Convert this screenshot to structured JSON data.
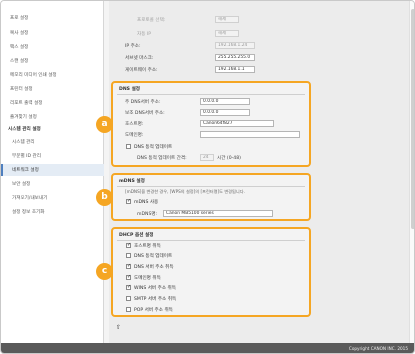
{
  "sidebar": {
    "items": [
      {
        "label": "프로 설정"
      },
      {
        "label": "복사 설정"
      },
      {
        "label": "팩스 설정"
      },
      {
        "label": "스캔 설정"
      },
      {
        "label": "메모리 미디어 인쇄 설정"
      },
      {
        "label": "프린터 설정"
      },
      {
        "label": "리포트 출력 설정"
      },
      {
        "label": "즐겨찾기 설정"
      },
      {
        "label": "시스템 관리 설정"
      },
      {
        "label": "시스템 관리"
      },
      {
        "label": "부문별 ID 관리"
      },
      {
        "label": "네트워크 설정"
      },
      {
        "label": "보안 설정"
      },
      {
        "label": "가져오기/내보내기"
      },
      {
        "label": "설정 정보 초기화"
      }
    ]
  },
  "top": {
    "prefix_select_label": "프로토콜 선택:",
    "prefix_select_value": "해제",
    "auto_ip_label": "자동 IP",
    "auto_ip_value": "해제",
    "ip_label": "IP 주소:",
    "ip_value": "192.168.1.24",
    "subnet_label": "서브넷 마스크:",
    "subnet_value": "255.255.255.0",
    "gateway_label": "게이트웨이 주소:",
    "gateway_value": "192.168.1.1"
  },
  "dns": {
    "title": "DNS 설정",
    "primary_label": "주 DNS서버 주소:",
    "primary_value": "0.0.0.0",
    "secondary_label": "보조 DNS서버 주소:",
    "secondary_value": "0.0.0.0",
    "host_label": "호스트명:",
    "host_value": "Canon64f827",
    "domain_label": "도메인명:",
    "domain_value": "",
    "dynamic_update_label": "DNS 동적 업데이트",
    "interval_label": "DNS 동적 업데이트 간격:",
    "interval_value": "24",
    "interval_unit": "시간 (0-48)"
  },
  "mdns": {
    "title": "mDNS 설정",
    "note": "[mDNS]을 변경한 경우, [WPS의 설정]의 [프린터명]도 변경됩니다.",
    "use_label": "mDNS 사용",
    "name_label": "mDNS명:",
    "name_value": "Canon MB5100 series"
  },
  "dhcp": {
    "title": "DHCP 옵션 설정",
    "options": [
      {
        "label": "호스트명 취득",
        "checked": true
      },
      {
        "label": "DNS 동적 업데이트",
        "checked": false
      },
      {
        "label": "DNS 서버 주소 취득",
        "checked": true
      },
      {
        "label": "도메인명 취득",
        "checked": true
      },
      {
        "label": "WINS 서버 주소 취득",
        "checked": true
      },
      {
        "label": "SMTP 서버 주소 취득",
        "checked": false
      },
      {
        "label": "POP 서버 주소 취득",
        "checked": false
      }
    ]
  },
  "badges": {
    "a": "a",
    "b": "b",
    "c": "c"
  },
  "footer": {
    "copyright": "Copyright CANON INC. 2015"
  },
  "colors": {
    "accent": "#f5a623",
    "selected": "#e4ecf5",
    "footer": "#5a5a5a"
  }
}
